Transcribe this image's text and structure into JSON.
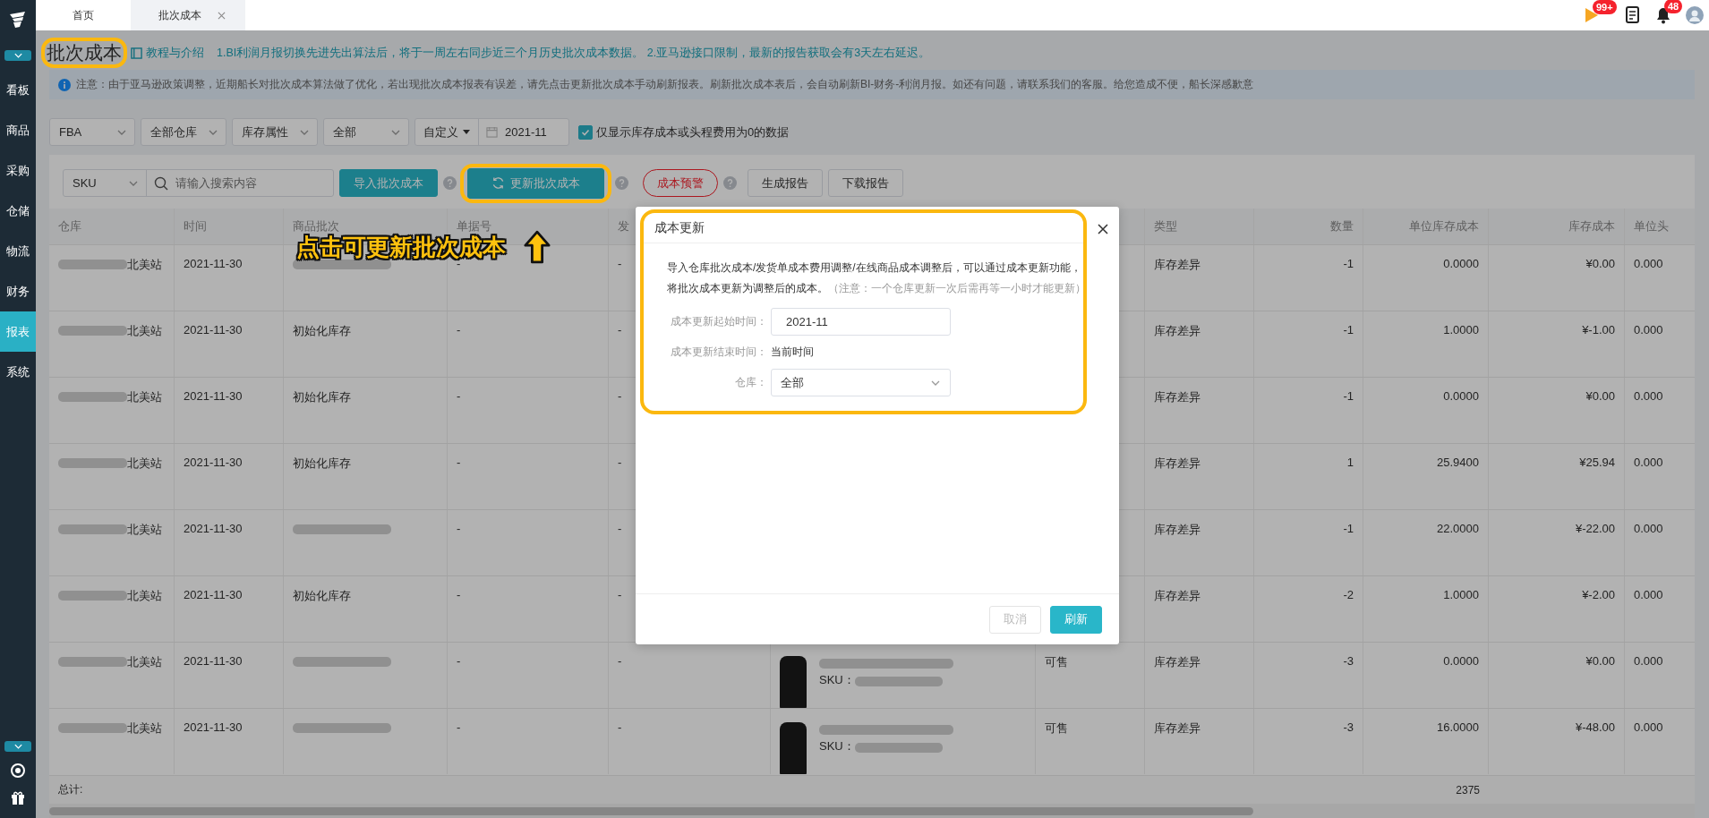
{
  "sidebar": {
    "items": [
      {
        "label": "看板",
        "selected": false
      },
      {
        "label": "商品",
        "selected": false
      },
      {
        "label": "采购",
        "selected": false
      },
      {
        "label": "仓储",
        "selected": false
      },
      {
        "label": "物流",
        "selected": false
      },
      {
        "label": "财务",
        "selected": false
      },
      {
        "label": "报表",
        "selected": true
      },
      {
        "label": "系统",
        "selected": false
      }
    ]
  },
  "tabs": [
    {
      "label": "首页",
      "selected": false,
      "closable": false
    },
    {
      "label": "批次成本",
      "selected": true,
      "closable": true
    }
  ],
  "header_icons": {
    "flag_badge": "99+",
    "bell_badge": "48"
  },
  "page": {
    "title": "批次成本",
    "help_link": "教程与介绍",
    "intro": "1.BI利润月报切换先进先出算法后，将于一周左右同步近三个月历史批次成本数据。 2.亚马逊接口限制，最新的报告获取会有3天左右延迟。",
    "notice": "注意：由于亚马逊政策调整，近期船长对批次成本算法做了优化，若出现批次成本报表有误差，请先点击更新批次成本手动刷新报表。刷新批次成本表后，会自动刷新BI-财务-利润月报。如还有问题，请联系我们的客服。给您造成不便，船长深感歉意"
  },
  "filters": {
    "selects": [
      "FBA",
      "全部仓库",
      "库存属性",
      "全部"
    ],
    "date_mode": "自定义",
    "date": "2021-11",
    "zero_only": {
      "label": "仅显示库存成本或头程费用为0的数据",
      "checked": true
    }
  },
  "toolbar": {
    "search_by": "SKU",
    "search_placeholder": "请输入搜索内容",
    "import_button": "导入批次成本",
    "update_button": "更新批次成本",
    "alert_button": "成本预警",
    "generate_button": "生成报告",
    "download_button": "下载报告"
  },
  "annotation": {
    "text": "点击可更新批次成本"
  },
  "table": {
    "columns": [
      {
        "label": "仓库"
      },
      {
        "label": "时间"
      },
      {
        "label": "商品批次"
      },
      {
        "label": "单据号"
      },
      {
        "label": "发"
      },
      {},
      {},
      {
        "label": "类型"
      },
      {
        "label": "数量"
      },
      {
        "label": "单位库存成本"
      },
      {
        "label": "库存成本"
      },
      {
        "label": "单位头"
      }
    ],
    "rows": [
      {
        "warehouse": "北美站",
        "time": "2021-11-30",
        "doc": "-",
        "ship": "-",
        "type": "库存差异",
        "qty": "-1",
        "unit_cost": "0.0000",
        "cost": "¥0.00",
        "unit_head": "0.000"
      },
      {
        "warehouse": "北美站",
        "time": "2021-11-30",
        "batch": "初始化库存",
        "doc": "-",
        "ship": "-",
        "type": "库存差异",
        "qty": "-1",
        "unit_cost": "1.0000",
        "cost": "¥-1.00",
        "unit_head": "0.000"
      },
      {
        "warehouse": "北美站",
        "time": "2021-11-30",
        "batch": "初始化库存",
        "doc": "-",
        "ship": "-",
        "type": "库存差异",
        "qty": "-1",
        "unit_cost": "0.0000",
        "cost": "¥0.00",
        "unit_head": "0.000"
      },
      {
        "warehouse": "北美站",
        "time": "2021-11-30",
        "batch": "初始化库存",
        "doc": "-",
        "ship": "-",
        "type": "库存差异",
        "qty": "1",
        "unit_cost": "25.9400",
        "cost": "¥25.94",
        "unit_head": "0.000"
      },
      {
        "warehouse": "北美站",
        "time": "2021-11-30",
        "doc": "-",
        "ship": "-",
        "type": "库存差异",
        "qty": "-1",
        "unit_cost": "22.0000",
        "cost": "¥-22.00",
        "unit_head": "0.000"
      },
      {
        "warehouse": "北美站",
        "time": "2021-11-30",
        "batch": "初始化库存",
        "doc": "-",
        "ship": "-",
        "type": "库存差异",
        "qty": "-2",
        "unit_cost": "1.0000",
        "cost": "¥-2.00",
        "unit_head": "0.000"
      },
      {
        "warehouse": "北美站",
        "time": "2021-11-30",
        "doc": "-",
        "ship": "-",
        "product": {
          "sku_label": "SKU："
        },
        "status": "可售",
        "type": "库存差异",
        "qty": "-3",
        "unit_cost": "0.0000",
        "cost": "¥0.00",
        "unit_head": "0.000"
      },
      {
        "warehouse": "北美站",
        "time": "2021-11-30",
        "doc": "-",
        "ship": "-",
        "product": {
          "sku_label": "SKU："
        },
        "status": "可售",
        "type": "库存差异",
        "qty": "-3",
        "unit_cost": "16.0000",
        "cost": "¥-48.00",
        "unit_head": "0.000"
      }
    ],
    "footer": {
      "label": "总计:",
      "total": "2375"
    }
  },
  "dialog": {
    "title": "成本更新",
    "description": "导入仓库批次成本/发货单成本费用调整/在线商品成本调整后，可以通过成本更新功能，将批次成本更新为调整后的成本。",
    "note": "（注意：一个仓库更新一次后需再等一小时才能更新）",
    "fields": [
      {
        "kind": "input",
        "label": "成本更新起始时间：",
        "value": "2021-11"
      },
      {
        "kind": "text",
        "label": "成本更新结束时间：",
        "value": "当前时间"
      },
      {
        "kind": "select",
        "label": "仓库：",
        "value": "全部"
      }
    ],
    "cancel_button": "取消",
    "confirm_button": "刷新"
  }
}
